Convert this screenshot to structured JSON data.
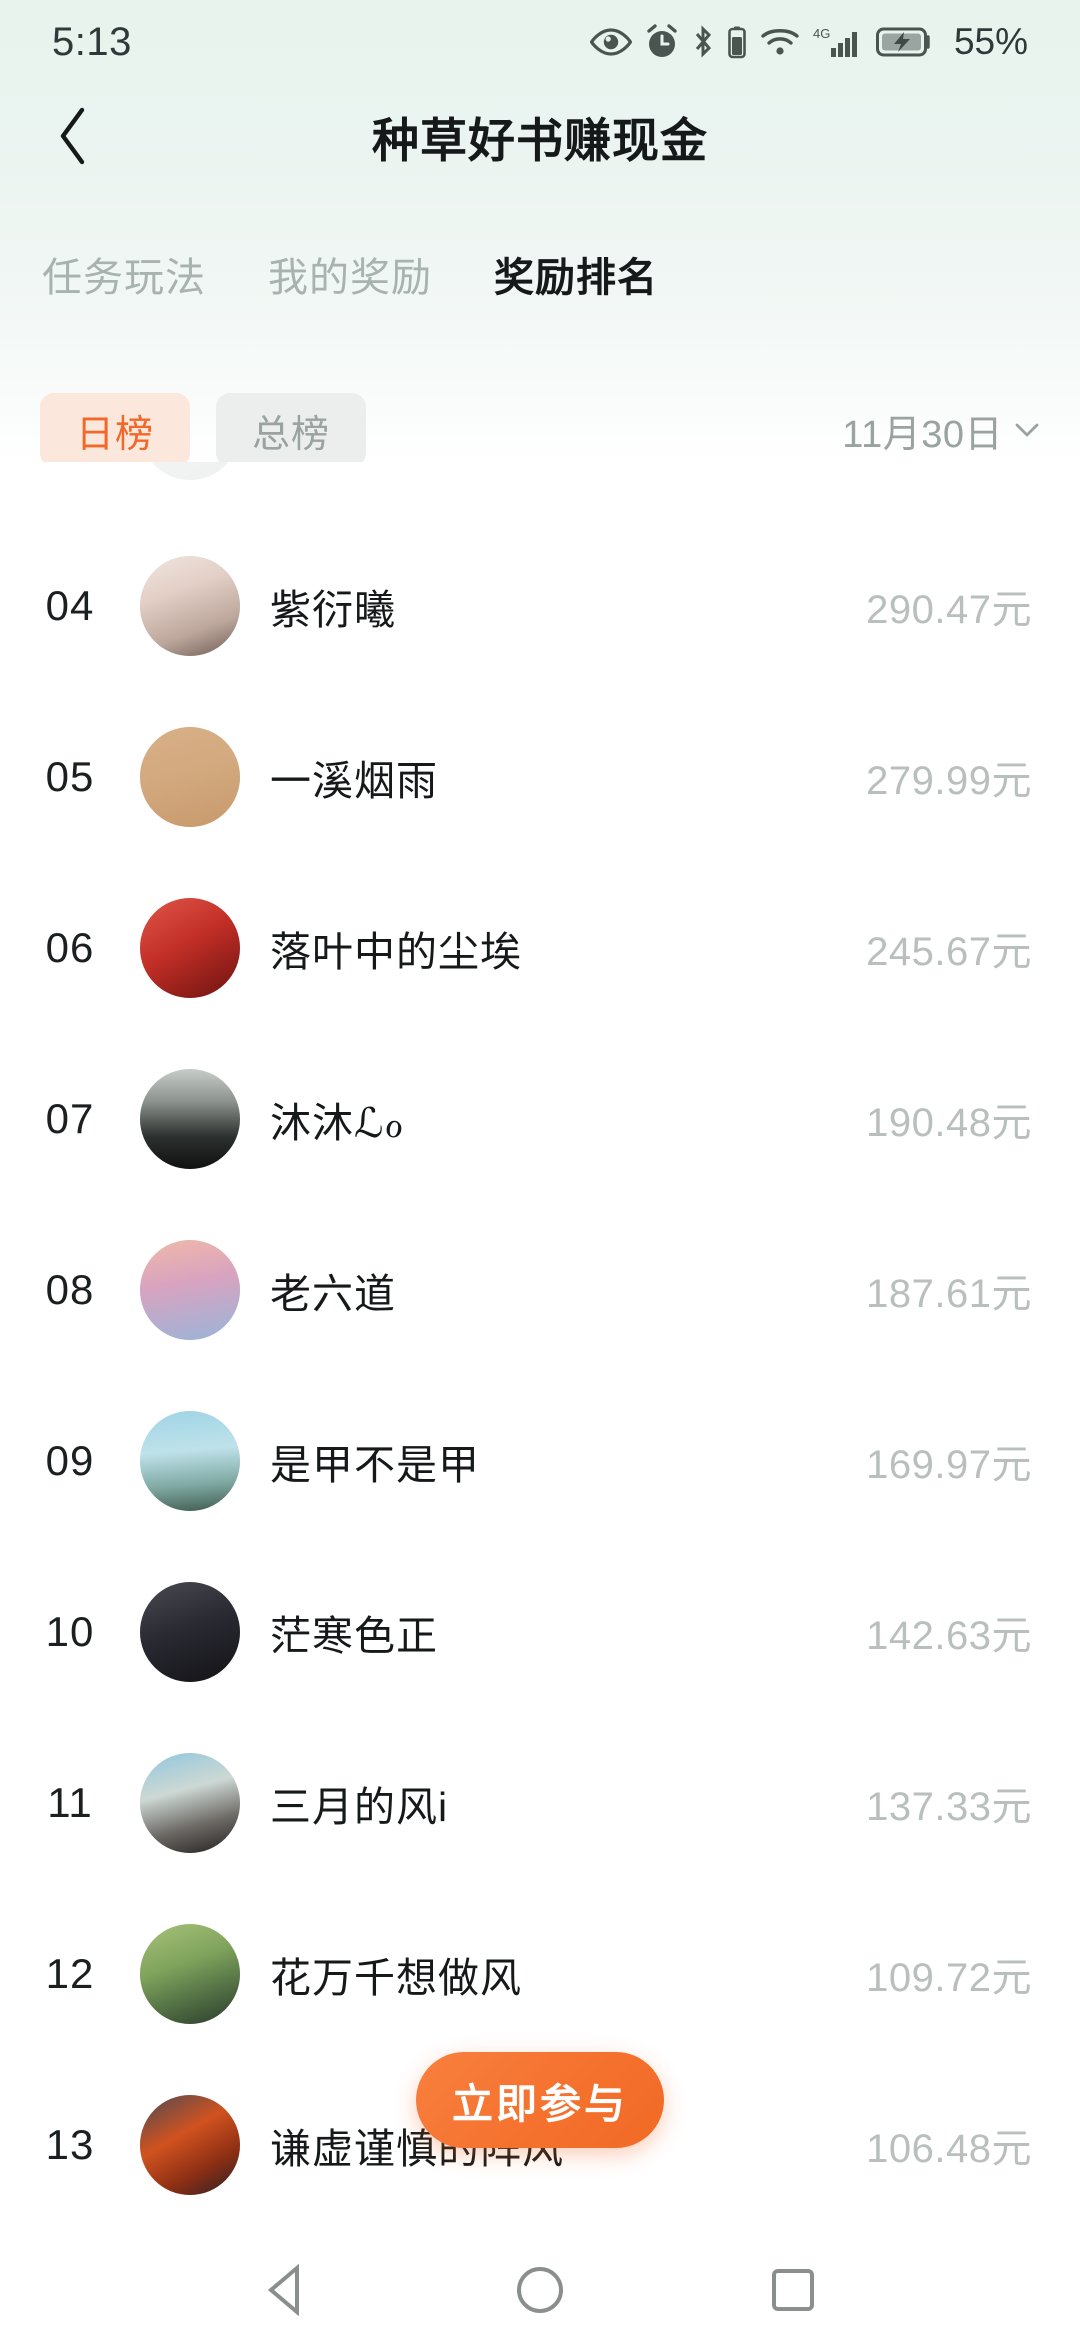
{
  "statusbar": {
    "time": "5:13",
    "battery_percent": "55%",
    "network": "4G",
    "icons": [
      "eye-care-icon",
      "alarm-icon",
      "bluetooth-icon",
      "wifi-icon",
      "signal-4g-icon",
      "battery-charging-icon"
    ]
  },
  "header": {
    "title": "种草好书赚现金",
    "back_icon": "back-chevron-icon"
  },
  "tabs": [
    {
      "label": "任务玩法",
      "active": false
    },
    {
      "label": "我的奖励",
      "active": false
    },
    {
      "label": "奖励排名",
      "active": true
    }
  ],
  "filters": {
    "chips": [
      {
        "label": "日榜",
        "active": true
      },
      {
        "label": "总榜",
        "active": false
      }
    ],
    "date": "11月30日",
    "date_chevron_icon": "chevron-down-icon"
  },
  "ranking": {
    "currency_suffix": "元",
    "rows": [
      {
        "rank": "04",
        "name": "紫衍曦",
        "amount": "290.47元",
        "avatar": "avatar-portrait-woman-light"
      },
      {
        "rank": "05",
        "name": "一溪烟雨",
        "amount": "279.99元",
        "avatar": "avatar-illustration-tan"
      },
      {
        "rank": "06",
        "name": "落叶中的尘埃",
        "amount": "245.67元",
        "avatar": "avatar-red-portrait"
      },
      {
        "rank": "07",
        "name": "沐沐ℒℴ",
        "amount": "190.48元",
        "avatar": "avatar-dark-figure"
      },
      {
        "rank": "08",
        "name": "老六道",
        "amount": "187.61元",
        "avatar": "avatar-sunset-text"
      },
      {
        "rank": "09",
        "name": "是甲不是甲",
        "amount": "169.97元",
        "avatar": "avatar-sky-silhouette"
      },
      {
        "rank": "10",
        "name": "茫寒色正",
        "amount": "142.63元",
        "avatar": "avatar-dark-face"
      },
      {
        "rank": "11",
        "name": "三月的风i",
        "amount": "137.33元",
        "avatar": "avatar-beach-woman"
      },
      {
        "rank": "12",
        "name": "花万千想做风",
        "amount": "109.72元",
        "avatar": "avatar-green-outdoor"
      },
      {
        "rank": "13",
        "name": "谦虚谨慎的阵风",
        "amount": "106.48元",
        "avatar": "avatar-lava-dark"
      }
    ]
  },
  "cta": {
    "label": "立即参与"
  },
  "navbar": {
    "back_icon": "nav-back-triangle-icon",
    "home_icon": "nav-home-circle-icon",
    "recents_icon": "nav-recents-square-icon"
  },
  "colors": {
    "accent": "#f2672a",
    "cta": "#f5712e",
    "header_bg": "#e8f3ee",
    "amount_text": "#b9bfbd",
    "tab_inactive": "#a8b2ae"
  }
}
